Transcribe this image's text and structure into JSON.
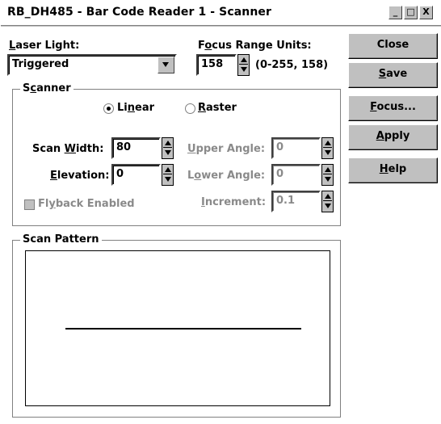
{
  "window": {
    "title": "RB_DH485 - Bar Code Reader 1 - Scanner",
    "controls": [
      "_",
      "□",
      "X"
    ]
  },
  "laser": {
    "label_pre": "",
    "label_u": "L",
    "label_post": "aser Light:",
    "value": "Triggered"
  },
  "focus_range": {
    "label_pre": "F",
    "label_u": "o",
    "label_post": "cus Range Units:",
    "value": "158",
    "hint": "(0-255, 158)"
  },
  "buttons": {
    "close": "Close",
    "save_u": "S",
    "save_post": "ave",
    "focus_u": "F",
    "focus_post": "ocus...",
    "apply_u": "A",
    "apply_post": "pply",
    "help_u": "H",
    "help_post": "elp"
  },
  "scanner": {
    "title_pre": "S",
    "title_u": "c",
    "title_post": "anner",
    "radio_linear_pre": "Li",
    "radio_linear_u": "n",
    "radio_linear_post": "ear",
    "radio_raster_u": "R",
    "radio_raster_post": "aster",
    "mode": "Linear",
    "scan_width_pre": "Scan ",
    "scan_width_u": "W",
    "scan_width_post": "idth:",
    "scan_width_value": "80",
    "elevation_u": "E",
    "elevation_post": "levation:",
    "elevation_value": "0",
    "upper_u": "U",
    "upper_post": "pper Angle:",
    "upper_value": "0",
    "lower_pre": "L",
    "lower_u": "o",
    "lower_post": "wer Angle:",
    "lower_value": "0",
    "increment_u": "I",
    "increment_post": "ncrement:",
    "increment_value": "0.1",
    "flyback_pre": "Fl",
    "flyback_u": "y",
    "flyback_post": "back Enabled",
    "flyback_checked": false
  },
  "scan_pattern": {
    "title": "Scan Pattern"
  }
}
